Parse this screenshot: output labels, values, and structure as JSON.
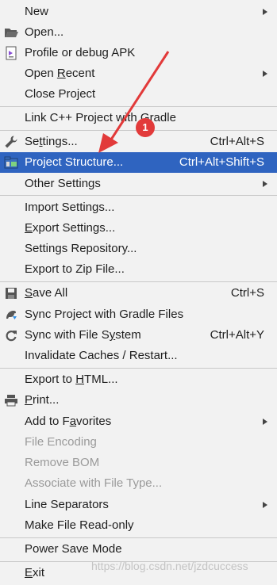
{
  "menu": {
    "new": {
      "label": "New"
    },
    "open": {
      "label": "Open..."
    },
    "profile": {
      "label": "Profile or debug APK"
    },
    "open_recent": {
      "pre": "Open ",
      "mn": "R",
      "post": "ecent"
    },
    "close_project": {
      "label": "Close Project"
    },
    "link_cpp": {
      "label": "Link C++ Project with Gradle"
    },
    "settings": {
      "pre": "Se",
      "mn": "t",
      "post": "tings...",
      "shortcut": "Ctrl+Alt+S"
    },
    "project_structure": {
      "label": "Project Structure...",
      "shortcut": "Ctrl+Alt+Shift+S"
    },
    "other_settings": {
      "label": "Other Settings"
    },
    "import_settings": {
      "label": "Import Settings..."
    },
    "export_settings": {
      "pre": "",
      "mn": "E",
      "post": "xport Settings..."
    },
    "settings_repo": {
      "label": "Settings Repository..."
    },
    "export_zip": {
      "label": "Export to Zip File..."
    },
    "save_all": {
      "pre": "",
      "mn": "S",
      "post": "ave All",
      "shortcut": "Ctrl+S"
    },
    "sync_gradle": {
      "label": "Sync Project with Gradle Files"
    },
    "sync_fs": {
      "pre": "Sync with File S",
      "mn": "y",
      "post": "stem",
      "shortcut": "Ctrl+Alt+Y"
    },
    "invalidate": {
      "label": "Invalidate Caches / Restart..."
    },
    "export_html": {
      "pre": "Export to ",
      "mn": "H",
      "post": "TML..."
    },
    "print": {
      "pre": "",
      "mn": "P",
      "post": "rint..."
    },
    "add_favorites": {
      "pre": "Add to F",
      "mn": "a",
      "post": "vorites"
    },
    "file_encoding": {
      "label": "File Encoding"
    },
    "remove_bom": {
      "label": "Remove BOM"
    },
    "associate": {
      "label": "Associate with File Type..."
    },
    "line_separators": {
      "label": "Line Separators"
    },
    "read_only": {
      "label": "Make File Read-only"
    },
    "power_save": {
      "label": "Power Save Mode"
    },
    "exit": {
      "pre": "",
      "mn": "E",
      "post": "xit"
    }
  },
  "annotation": {
    "badge": "1",
    "color": "#e23a3a"
  },
  "watermark": "https://blog.csdn.net/jzdcuccess",
  "colors": {
    "selected_bg": "#2f64c0",
    "background": "#f2f2f2",
    "disabled_text": "#9a9a9a"
  }
}
